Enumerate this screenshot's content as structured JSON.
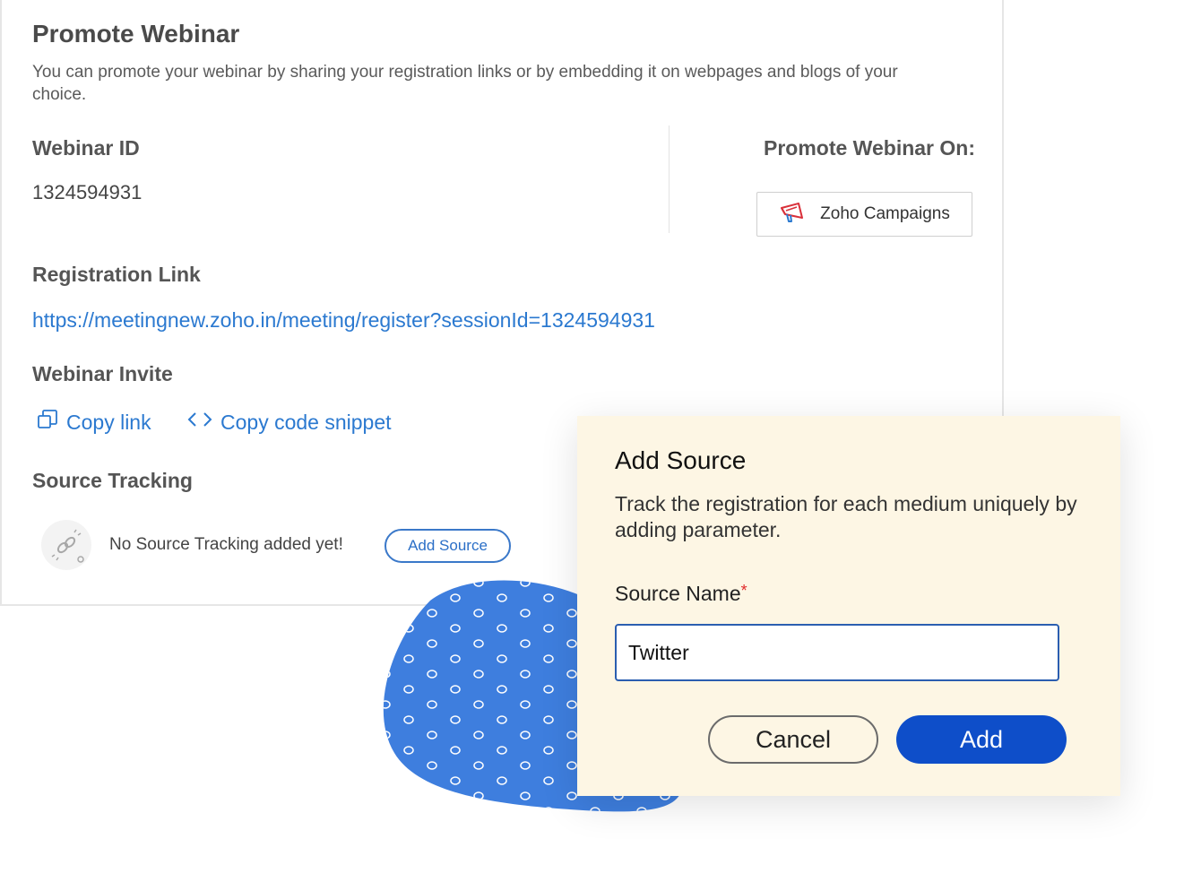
{
  "panel": {
    "title": "Promote Webinar",
    "description": "You can promote your webinar by sharing your registration links or by embedding it on webpages and blogs of your choice.",
    "webinar_id_label": "Webinar ID",
    "webinar_id_value": "1324594931",
    "promote_on_label": "Promote Webinar On:",
    "zoho_campaigns_label": "Zoho Campaigns",
    "registration_link_label": "Registration Link",
    "registration_link": "https://meetingnew.zoho.in/meeting/register?sessionId=1324594931",
    "webinar_invite_label": "Webinar Invite",
    "copy_link_label": "Copy link",
    "copy_code_label": "Copy code snippet",
    "source_tracking_label": "Source Tracking",
    "empty_state_text": "No Source Tracking added yet!",
    "add_source_button": "Add Source"
  },
  "dialog": {
    "title": "Add Source",
    "description": "Track the registration for each medium uniquely by adding parameter.",
    "field_label": "Source Name",
    "required_mark": "*",
    "source_name_value": "Twitter",
    "cancel_label": "Cancel",
    "add_label": "Add"
  },
  "colors": {
    "link_blue": "#2b79d0",
    "primary_button": "#0e4ec9",
    "dialog_bg": "#fdf6e4",
    "blob_blue": "#3e7ede"
  },
  "icons": {
    "campaigns": "megaphone-icon",
    "copy_link": "copy-icon",
    "copy_code": "code-icon",
    "empty_state": "link-icon"
  }
}
